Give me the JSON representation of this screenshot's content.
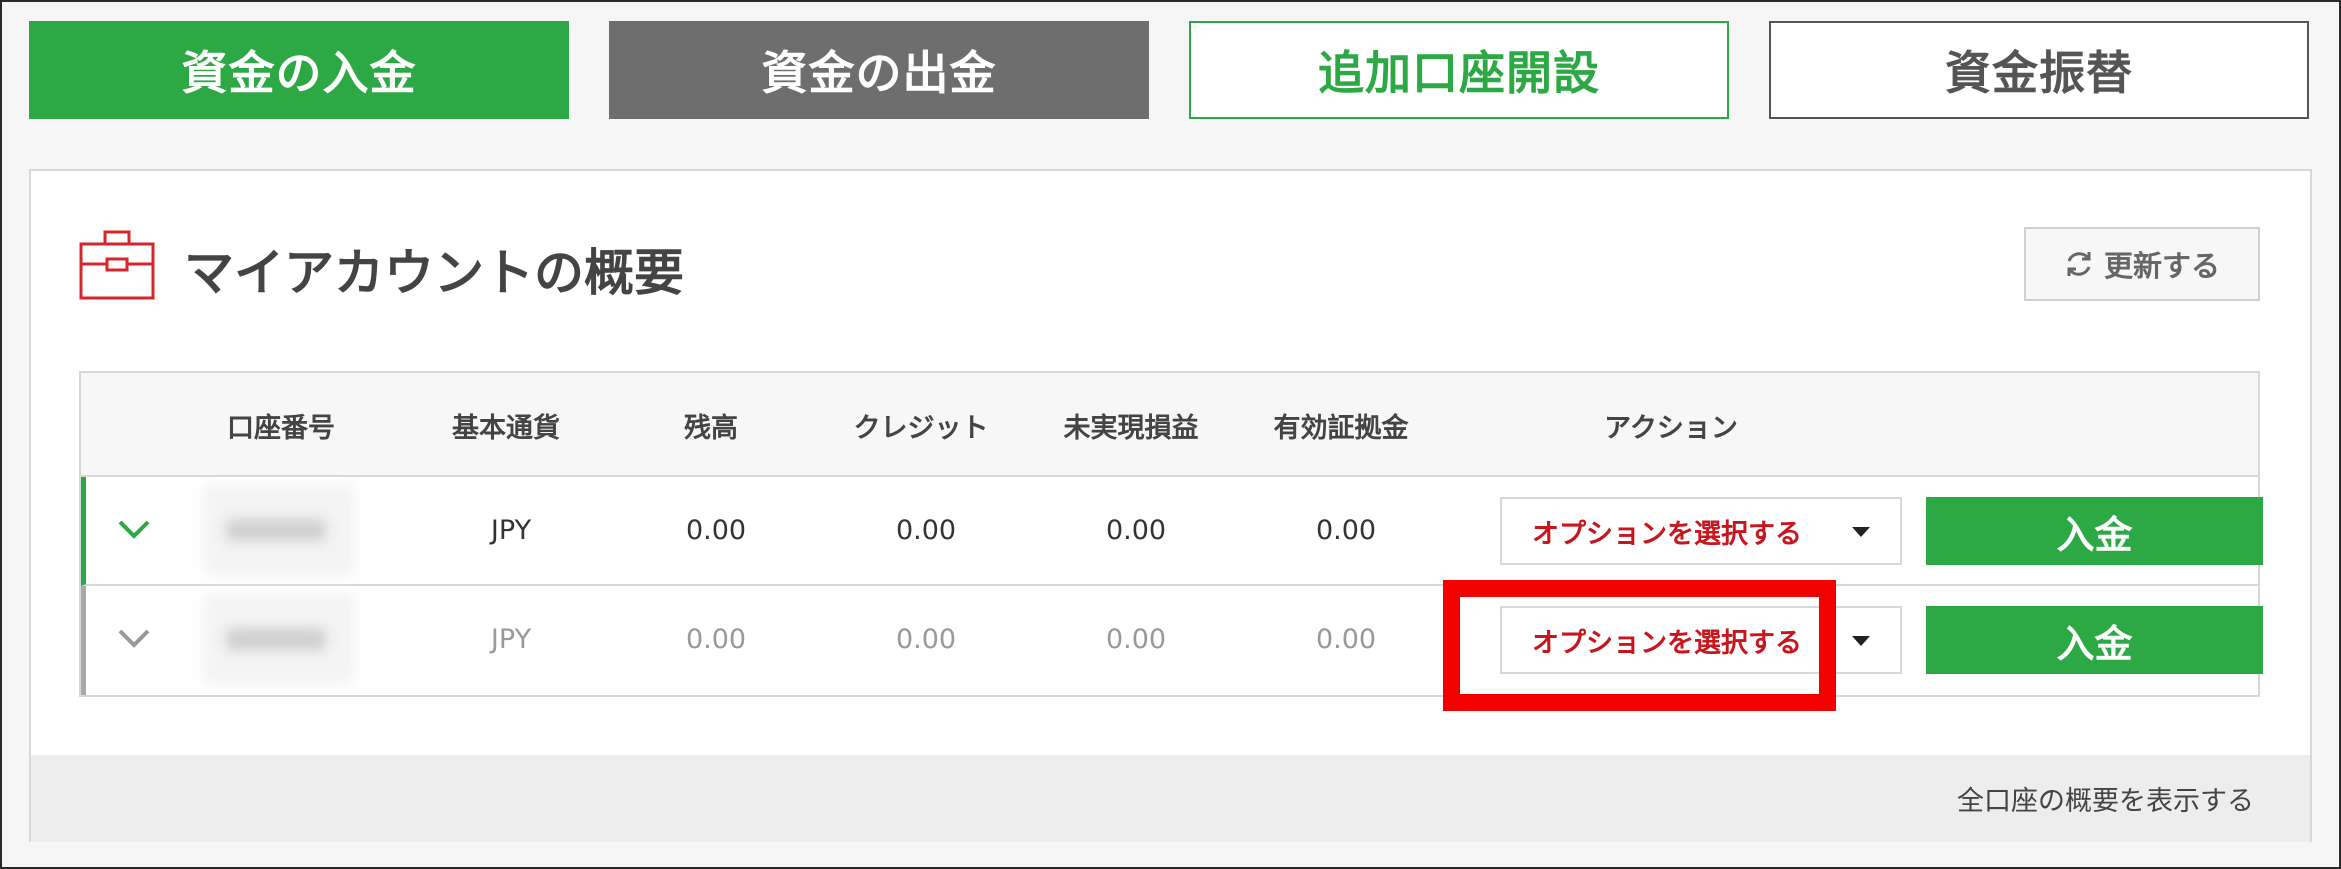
{
  "top_buttons": {
    "deposit": "資金の入金",
    "withdraw": "資金の出金",
    "open_account": "追加口座開設",
    "transfer": "資金振替"
  },
  "panel": {
    "title": "マイアカウントの概要",
    "refresh_label": "更新する",
    "footer_link": "全口座の概要を表示する"
  },
  "table": {
    "headers": [
      "口座番号",
      "基本通貨",
      "残高",
      "クレジット",
      "未実現損益",
      "有効証拠金",
      "アクション"
    ],
    "rows": [
      {
        "currency": "JPY",
        "balance": "0.00",
        "credit": "0.00",
        "unrealized": "0.00",
        "equity": "0.00",
        "select": "オプションを選択する",
        "deposit": "入金"
      },
      {
        "currency": "JPY",
        "balance": "0.00",
        "credit": "0.00",
        "unrealized": "0.00",
        "equity": "0.00",
        "select": "オプションを選択する",
        "deposit": "入金"
      }
    ]
  },
  "colors": {
    "accent_green": "#2ca844",
    "accent_red": "#c8161e",
    "highlight_red": "#f20000",
    "gray_button": "#6e6e6e"
  },
  "icons": [
    "briefcase-icon",
    "refresh-icon",
    "chevron-down-icon",
    "dropdown-caret-icon"
  ]
}
